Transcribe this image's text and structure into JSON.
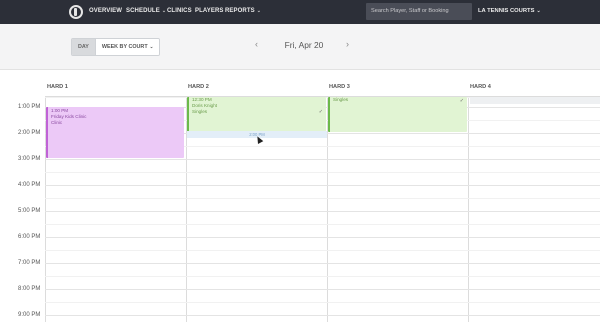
{
  "nav": {
    "overview": "OVERVIEW",
    "schedule": "SCHEDULE",
    "clinics": "CLINICS",
    "players": "PLAYERS",
    "reports": "REPORTS",
    "caret": "⌄"
  },
  "search": {
    "placeholder": "Search Player, Staff or Booking"
  },
  "venue": {
    "label": "LA TENNIS COURTS",
    "caret": "⌄"
  },
  "toolbar": {
    "view_day": "DAY",
    "view_week": "WEEK BY COURT",
    "caret": "⌄",
    "prev": "‹",
    "next": "›",
    "date": "Fri, Apr 20"
  },
  "columns": [
    "HARD 1",
    "HARD 2",
    "HARD 3",
    "HARD 4"
  ],
  "times": [
    "1:00 PM",
    "2:00 PM",
    "3:00 PM",
    "4:00 PM",
    "5:00 PM",
    "6:00 PM",
    "7:00 PM",
    "8:00 PM",
    "9:00 PM"
  ],
  "events": {
    "hard1": {
      "time": "1:00 PM",
      "title": "Friday Kids Clinic",
      "type": "Clinic"
    },
    "hard2": {
      "time": "12:30 PM",
      "name": "Doris Knight",
      "type": "Singles"
    },
    "hard3": {
      "type": "Singles"
    },
    "hover_slot": "2:00 PM"
  },
  "colors": {
    "topbar": "#2c2f38",
    "clinic": "#ecc9f7",
    "booking": "#e1f4d3"
  },
  "icons": {
    "check": "✓"
  }
}
